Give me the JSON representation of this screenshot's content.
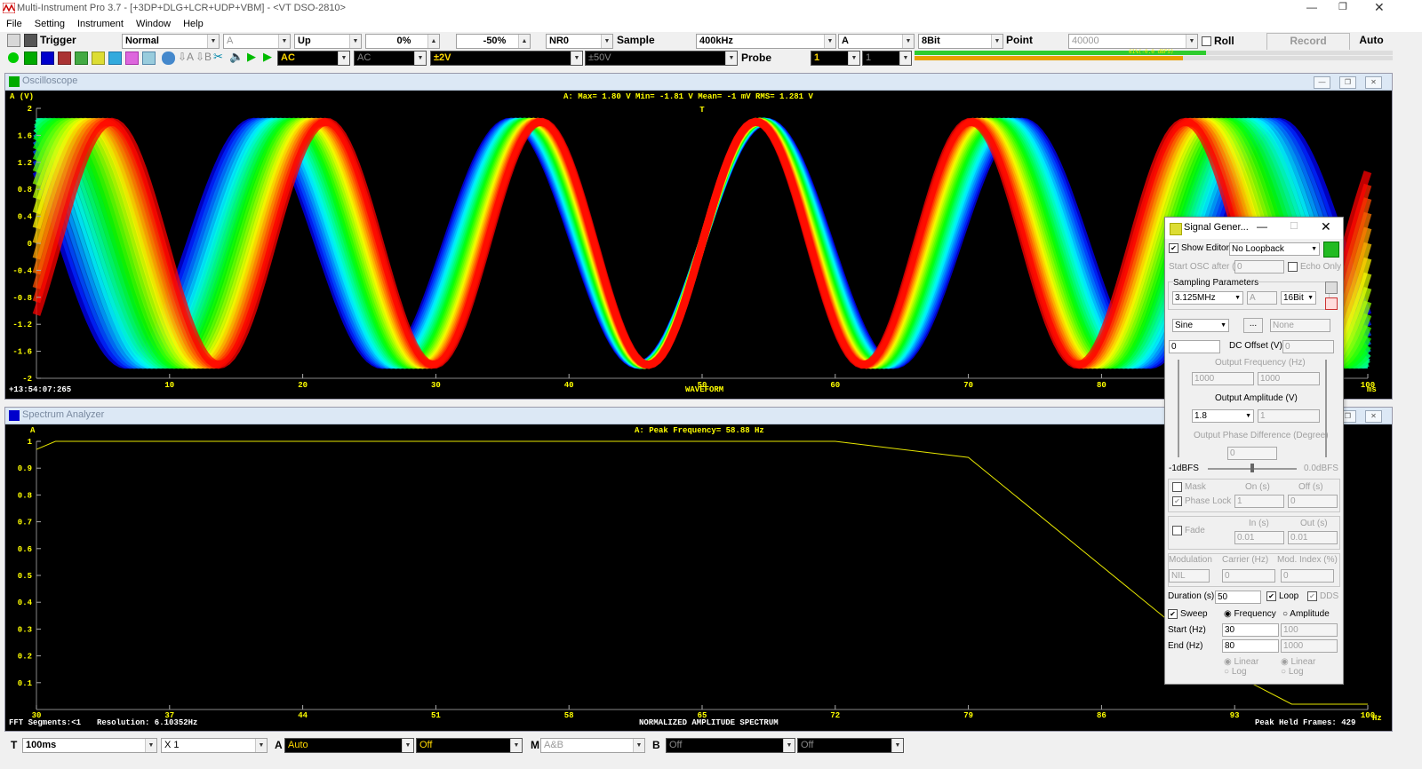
{
  "app": {
    "title": "Multi-Instrument Pro 3.7  -  [+3DP+DLG+LCR+UDP+VBM]  -  <VT DSO-2810>"
  },
  "menu": [
    "File",
    "Setting",
    "Instrument",
    "Window",
    "Help"
  ],
  "toolbar1": {
    "trigger_label": "Trigger",
    "mode": "Normal",
    "source": "A",
    "edge": "Up",
    "level": "0%",
    "position": "-50%",
    "nr": "NR0",
    "sample_label": "Sample",
    "rate": "400kHz",
    "channel": "A",
    "bits": "8Bit",
    "point_label": "Point",
    "points": "40000",
    "roll_label": "Roll",
    "record_label": "Record",
    "auto_label": "Auto"
  },
  "toolbar2": {
    "coupling_a": "AC",
    "coupling_b": "AC",
    "range_a": "±2V",
    "range_b": "±50V",
    "probe_label": "Probe",
    "probe_a": "1",
    "probe_b": "1",
    "progress_text": "61%(-0.0 dBFS)",
    "progress": 0.61
  },
  "osc": {
    "title": "Oscilloscope",
    "ylabel": "A (V)",
    "stats": "A: Max=  1.80  V  Min= -1.81  V  Mean=    -1 mV  RMS=  1.281  V",
    "yticks": [
      "2",
      "1.6",
      "1.2",
      "0.8",
      "0.4",
      "0",
      "-0.4",
      "-0.8",
      "-1.2",
      "-1.6",
      "-2"
    ],
    "xticks": [
      "10",
      "20",
      "30",
      "40",
      "50",
      "60",
      "70",
      "80",
      "90",
      "100"
    ],
    "xunit": "ms",
    "time": "+13:54:07:265",
    "footer": "WAVEFORM"
  },
  "spec": {
    "title": "Spectrum Analyzer",
    "ylabel": "A",
    "peak": "A: Peak Frequency=    58.88  Hz",
    "yticks": [
      "1",
      "0.9",
      "0.8",
      "0.7",
      "0.6",
      "0.5",
      "0.4",
      "0.3",
      "0.2",
      "0.1"
    ],
    "xticks": [
      "30",
      "37",
      "44",
      "51",
      "58",
      "65",
      "72",
      "79",
      "86",
      "93",
      "100"
    ],
    "xunit": "Hz",
    "fft": "FFT Segments:<1",
    "resolution": "Resolution: 6.10352Hz",
    "footer": "NORMALIZED AMPLITUDE SPECTRUM",
    "held": "Peak Held Frames: 429"
  },
  "chart_data": [
    {
      "type": "line",
      "title": "WAVEFORM",
      "ylabel": "A (V)",
      "xlabel": "ms",
      "xlim": [
        0,
        100
      ],
      "ylim": [
        -2,
        2
      ],
      "series": [
        {
          "name": "A",
          "description_values": {
            "max": 1.8,
            "min": -1.81,
            "mean_mV": -1,
            "rms": 1.281
          }
        }
      ]
    },
    {
      "type": "line",
      "title": "NORMALIZED AMPLITUDE SPECTRUM",
      "xlabel": "Hz",
      "ylabel": "A",
      "xlim": [
        30,
        100
      ],
      "ylim": [
        0,
        1
      ],
      "x": [
        30,
        31,
        72,
        79,
        93,
        96,
        100
      ],
      "series": [
        {
          "name": "A",
          "values": [
            0.97,
            1.0,
            1.0,
            0.94,
            0.13,
            0.02,
            0.02
          ]
        }
      ]
    }
  ],
  "siggen": {
    "title": "Signal Gener...",
    "show_editor": "Show Editor",
    "loopback": "No Loopback",
    "start_osc": "Start OSC after (s)",
    "start_osc_val": "0",
    "echo_only": "Echo Only",
    "sampling": "Sampling Parameters",
    "samp_rate": "3.125MHz",
    "samp_ch": "A",
    "samp_bits": "16Bit",
    "wave": "Sine",
    "wave_more": "...",
    "wave_b": "None",
    "offset_a": "0",
    "dc_offset": "DC Offset (V)",
    "offset_b": "0",
    "out_freq": "Output Frequency (Hz)",
    "freq_a": "1000",
    "freq_b": "1000",
    "out_amp": "Output Amplitude (V)",
    "amp_a": "1.8",
    "amp_b": "1",
    "phase_diff": "Output Phase Difference (Degree)",
    "phase": "0",
    "dbfs_left": "-1dBFS",
    "dbfs_right": "0.0dBFS",
    "mask": "Mask",
    "on_s": "On (s)",
    "off_s": "Off (s)",
    "phase_lock": "Phase Lock",
    "on_val": "1",
    "off_val": "0",
    "fade": "Fade",
    "in_s": "In (s)",
    "out_s": "Out (s)",
    "in_val": "0.01",
    "out_val": "0.01",
    "modulation": "Modulation",
    "carrier": "Carrier (Hz)",
    "mod_index": "Mod. Index (%)",
    "mod_val": "NIL",
    "carrier_val": "0",
    "index_val": "0",
    "duration": "Duration (s)",
    "duration_val": "50",
    "loop": "Loop",
    "dds": "DDS",
    "sweep": "Sweep",
    "frequency": "Frequency",
    "amplitude": "Amplitude",
    "start_hz": "Start (Hz)",
    "start_a": "30",
    "start_b": "100",
    "end_hz": "End (Hz)",
    "end_a": "80",
    "end_b": "1000",
    "linear": "Linear",
    "log": "Log"
  },
  "bottom": {
    "t": "T",
    "t_val": "100ms",
    "x_val": "X 1",
    "a": "A",
    "a_val": "Auto",
    "a_off": "Off",
    "m": "M",
    "m_val": "A&B",
    "b": "B",
    "b_val": "Off",
    "b_off": "Off"
  }
}
